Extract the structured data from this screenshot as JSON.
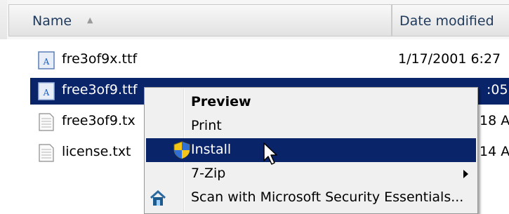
{
  "header": {
    "name_label": "Name",
    "date_label": "Date modified"
  },
  "files": [
    {
      "name": "fre3of9x.ttf",
      "date": "1/17/2001 6:27",
      "icon": "font-file-icon",
      "selected": false
    },
    {
      "name": "free3of9.ttf",
      "date": ":05",
      "icon": "font-file-icon",
      "selected": true
    },
    {
      "name": "free3of9.tx",
      "date": "18 A",
      "icon": "text-file-icon",
      "selected": false
    },
    {
      "name": "license.txt",
      "date": "14 A",
      "icon": "text-file-icon",
      "selected": false
    }
  ],
  "context_menu": {
    "items": [
      {
        "label": "Preview",
        "bold": true
      },
      {
        "label": "Print"
      },
      {
        "label": "Install",
        "icon": "uac-shield-icon",
        "highlighted": true
      },
      {
        "label": "7-Zip",
        "submenu": true
      },
      {
        "label": "Scan with Microsoft Security Essentials...",
        "icon": "security-essentials-icon"
      }
    ]
  },
  "colors": {
    "selection": "#0a246a",
    "menu_background": "#f0f0f0",
    "header_text": "#1e395b"
  }
}
